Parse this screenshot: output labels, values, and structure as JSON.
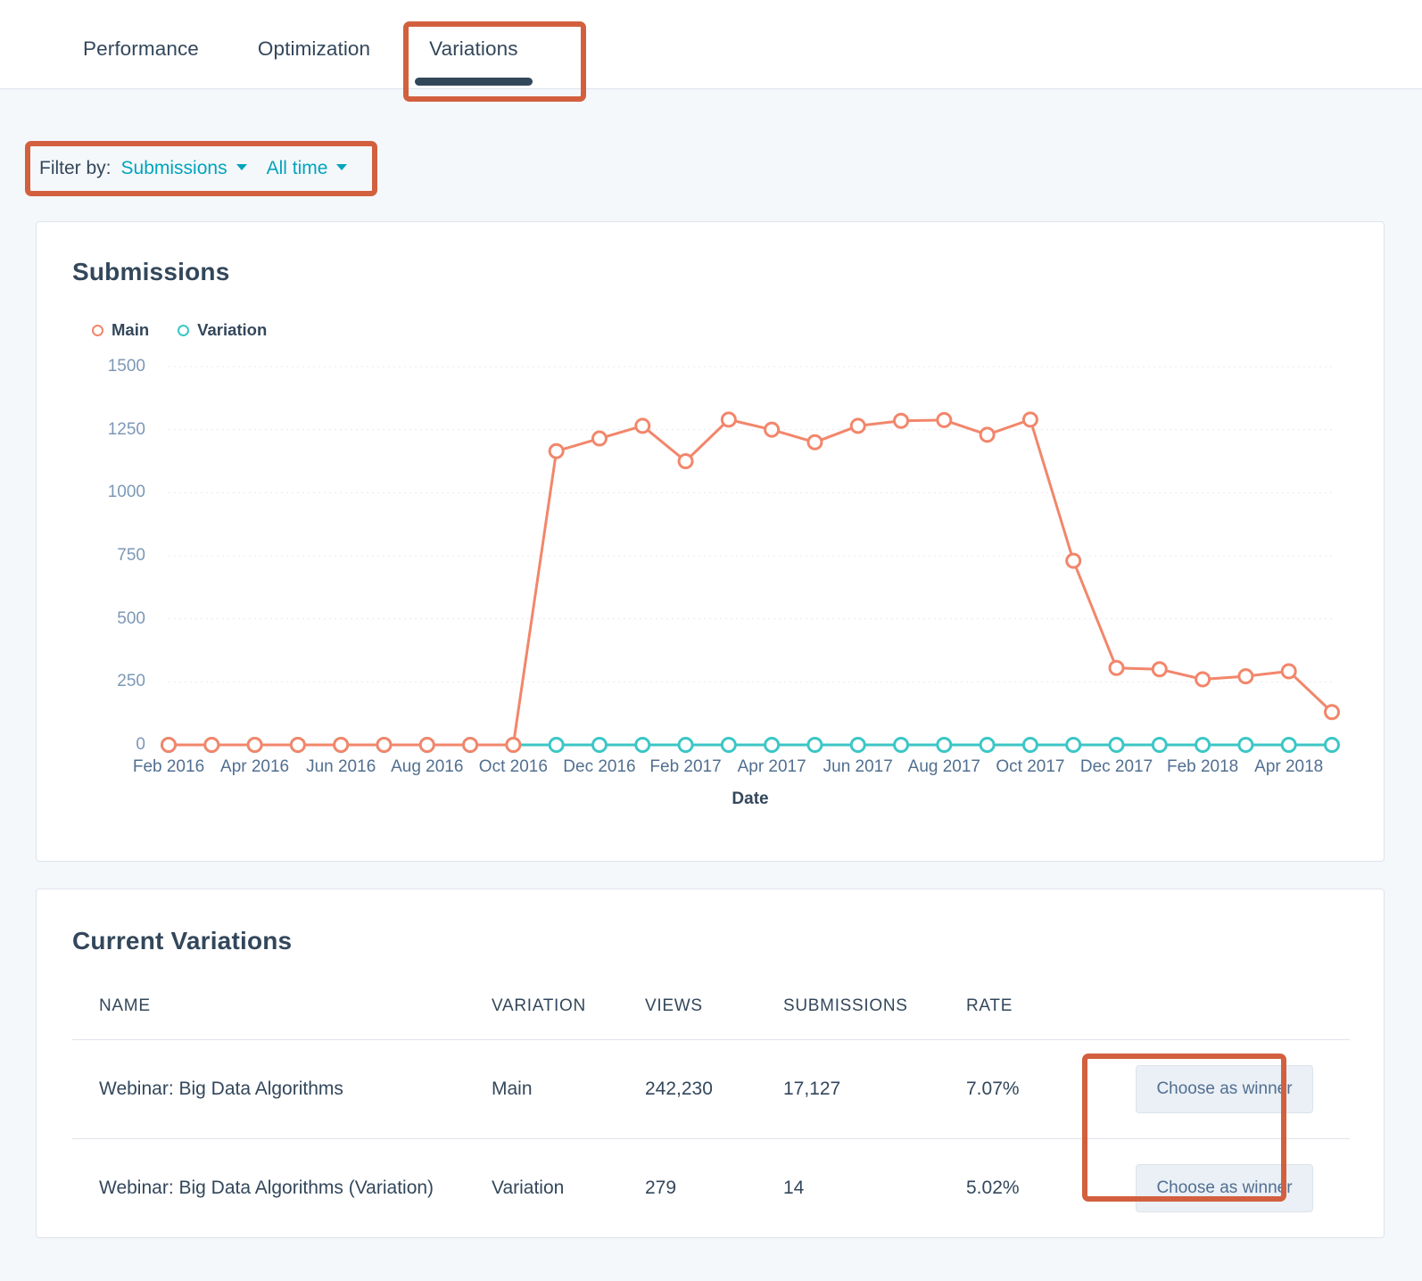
{
  "tabs": [
    {
      "label": "Performance",
      "active": false
    },
    {
      "label": "Optimization",
      "active": false
    },
    {
      "label": "Variations",
      "active": true
    }
  ],
  "filter": {
    "label": "Filter by:",
    "metric": "Submissions",
    "range": "All time"
  },
  "chart_card": {
    "title": "Submissions"
  },
  "table_card": {
    "title": "Current Variations",
    "columns": [
      "NAME",
      "VARIATION",
      "VIEWS",
      "SUBMISSIONS",
      "RATE",
      ""
    ],
    "rows": [
      {
        "name": "Webinar: Big Data Algorithms",
        "variation": "Main",
        "views": "242,230",
        "submissions": "17,127",
        "rate": "7.07%",
        "action": "Choose as winner"
      },
      {
        "name": "Webinar: Big Data Algorithms (Variation)",
        "variation": "Variation",
        "views": "279",
        "submissions": "14",
        "rate": "5.02%",
        "action": "Choose as winner"
      }
    ]
  },
  "colors": {
    "main_series": "#f2866b",
    "variation_series": "#3cc6c6",
    "accent_link": "#00a4bd",
    "annotation": "#d2603e",
    "text_dark": "#33475b",
    "page_bg": "#f5f8fa",
    "card_bg": "#ffffff"
  },
  "chart_data": {
    "type": "line",
    "title": "Submissions",
    "xlabel": "Date",
    "ylabel": "",
    "ylim": [
      0,
      1500
    ],
    "yticks": [
      0,
      250,
      500,
      750,
      1000,
      1250,
      1500
    ],
    "grid": true,
    "legend_position": "top-left",
    "x": [
      "Feb 2016",
      "Mar 2016",
      "Apr 2016",
      "May 2016",
      "Jun 2016",
      "Jul 2016",
      "Aug 2016",
      "Sep 2016",
      "Oct 2016",
      "Nov 2016",
      "Dec 2016",
      "Jan 2017",
      "Feb 2017",
      "Mar 2017",
      "Apr 2017",
      "May 2017",
      "Jun 2017",
      "Jul 2017",
      "Aug 2017",
      "Sep 2017",
      "Oct 2017",
      "Nov 2017",
      "Dec 2017",
      "Jan 2018",
      "Feb 2018",
      "Mar 2018",
      "Apr 2018",
      "May 2018"
    ],
    "xtick_labels": [
      "Feb 2016",
      "Apr 2016",
      "Jun 2016",
      "Aug 2016",
      "Oct 2016",
      "Dec 2016",
      "Feb 2017",
      "Apr 2017",
      "Jun 2017",
      "Aug 2017",
      "Oct 2017",
      "Dec 2017",
      "Feb 2018",
      "Apr 2018"
    ],
    "series": [
      {
        "name": "Main",
        "color": "#f2866b",
        "values": [
          0,
          0,
          0,
          0,
          0,
          0,
          0,
          0,
          0,
          1165,
          1215,
          1265,
          1125,
          1290,
          1250,
          1200,
          1265,
          1285,
          1288,
          1230,
          1290,
          730,
          305,
          300,
          260,
          272,
          292,
          130
        ]
      },
      {
        "name": "Variation",
        "color": "#3cc6c6",
        "values": [
          0,
          0,
          0,
          0,
          0,
          0,
          0,
          0,
          0,
          0,
          0,
          0,
          0,
          0,
          0,
          0,
          0,
          0,
          0,
          0,
          0,
          0,
          0,
          0,
          0,
          0,
          0,
          0
        ]
      }
    ]
  }
}
